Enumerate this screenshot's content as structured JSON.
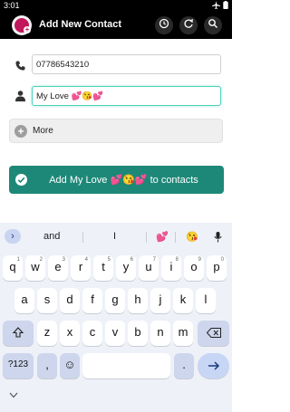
{
  "status": {
    "time": "3:01"
  },
  "header": {
    "title": "Add New Contact"
  },
  "form": {
    "phone_value": "07786543210",
    "name_value": "My Love 💕😘💕"
  },
  "more": {
    "label": "More"
  },
  "add_button": {
    "label": "Add My Love 💕😘💕 to contacts"
  },
  "keyboard": {
    "suggestions": [
      "and",
      "I",
      "💕",
      "😘"
    ],
    "row1": [
      "q",
      "w",
      "e",
      "r",
      "t",
      "y",
      "u",
      "i",
      "o",
      "p"
    ],
    "row1_hints": [
      "1",
      "2",
      "3",
      "4",
      "5",
      "6",
      "7",
      "8",
      "9",
      "0"
    ],
    "row2": [
      "a",
      "s",
      "d",
      "f",
      "g",
      "h",
      "j",
      "k",
      "l"
    ],
    "row3": [
      "z",
      "x",
      "c",
      "v",
      "b",
      "n",
      "m"
    ],
    "symbols_label": "?123",
    "comma": ",",
    "emoji_label": "☺",
    "period": "."
  }
}
